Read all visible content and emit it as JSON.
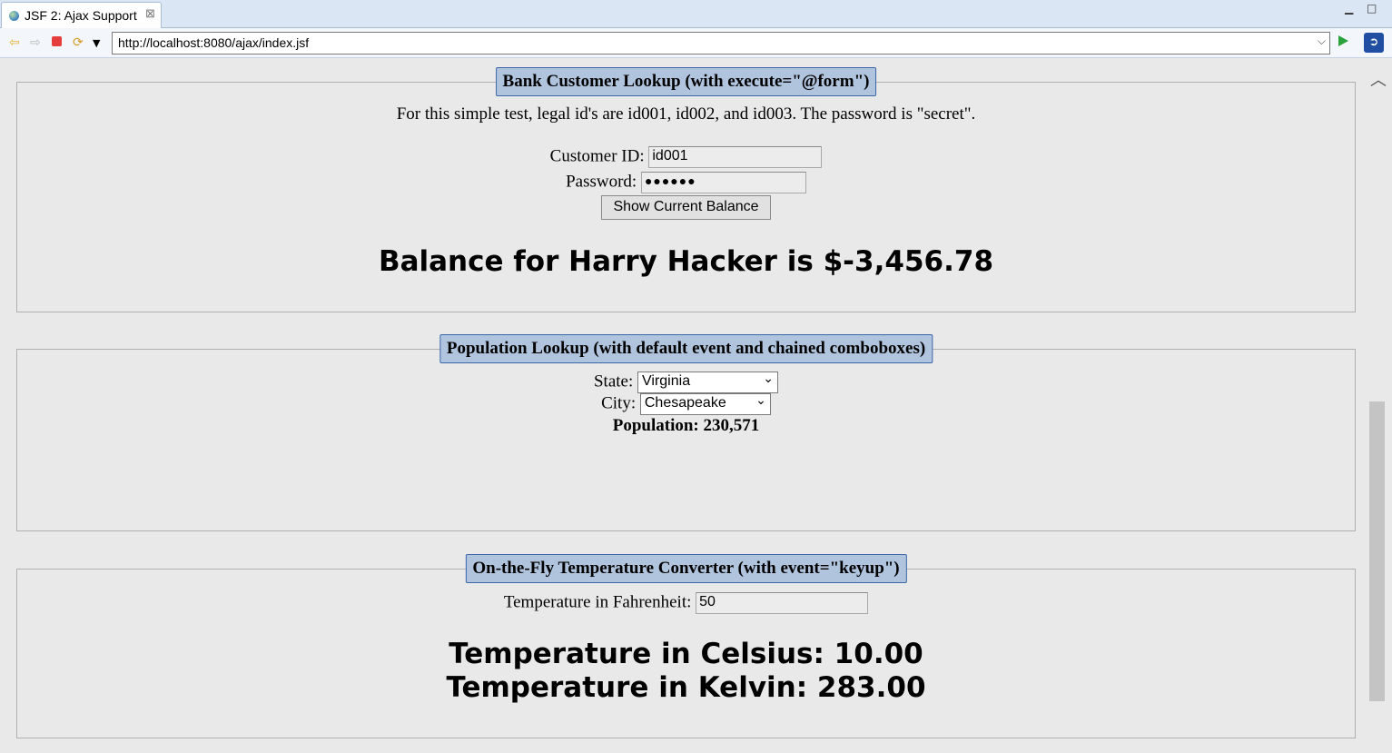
{
  "browser": {
    "tab_title": "JSF 2: Ajax Support",
    "url": "http://localhost:8080/ajax/index.jsf"
  },
  "bank": {
    "legend": "Bank Customer Lookup (with execute=\"@form\")",
    "hint": "For this simple test, legal id's are id001, id002, and id003. The password is \"secret\".",
    "customer_id_label": "Customer ID:",
    "customer_id_value": "id001",
    "password_label": "Password:",
    "password_value": "●●●●●●",
    "button_label": "Show Current Balance",
    "balance_text": "Balance for Harry Hacker is $-3,456.78"
  },
  "population": {
    "legend": "Population Lookup (with default event and chained comboboxes)",
    "state_label": "State:",
    "state_value": "Virginia",
    "city_label": "City:",
    "city_value": "Chesapeake",
    "population_text": "Population: 230,571"
  },
  "temperature": {
    "legend": "On-the-Fly Temperature Converter (with event=\"keyup\")",
    "fahrenheit_label": "Temperature in Fahrenheit:",
    "fahrenheit_value": "50",
    "celsius_text": "Temperature in Celsius: 10.00",
    "kelvin_text": "Temperature in Kelvin: 283.00"
  }
}
